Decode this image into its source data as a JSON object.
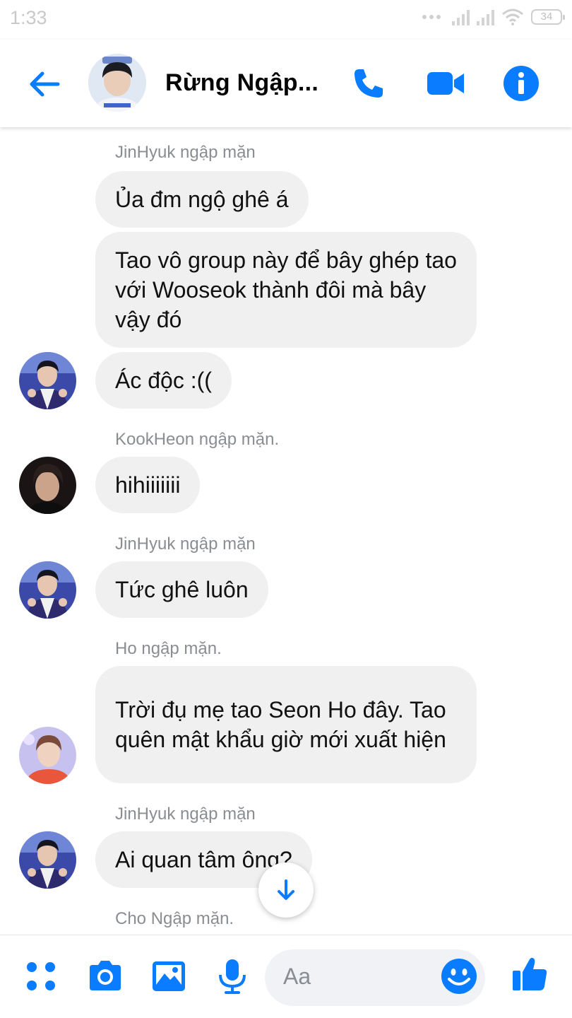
{
  "status": {
    "time": "1:33",
    "battery": "34"
  },
  "header": {
    "title": "Rừng Ngập..."
  },
  "messages": [
    {
      "sender": "JinHyuk ngập mặn",
      "bubbles": [
        "Ủa đm ngộ ghê á",
        "Tao vô group này để bây ghép tao với Wooseok thành đôi mà bây vậy đó",
        "Ác độc :(("
      ]
    },
    {
      "sender": "KookHeon ngập mặn.",
      "bubbles": [
        "hihiiiiiii"
      ]
    },
    {
      "sender": "JinHyuk ngập mặn",
      "bubbles": [
        "Tức ghê luôn"
      ]
    },
    {
      "sender": "Ho ngập mặn.",
      "bubbles": [
        "Trời đụ mẹ tao Seon Ho đây. Tao quên mật khẩu giờ mới xuất hiện"
      ]
    },
    {
      "sender": "JinHyuk ngập mặn",
      "bubbles": [
        "Ai quan tâm ông?"
      ]
    },
    {
      "sender": "Cho Ngập mặn.",
      "bubbles": []
    }
  ],
  "composer": {
    "placeholder": "Aa"
  },
  "colors": {
    "accent": "#0a7cff",
    "bubble": "#f0f0f0",
    "meta": "#8a8d91"
  }
}
